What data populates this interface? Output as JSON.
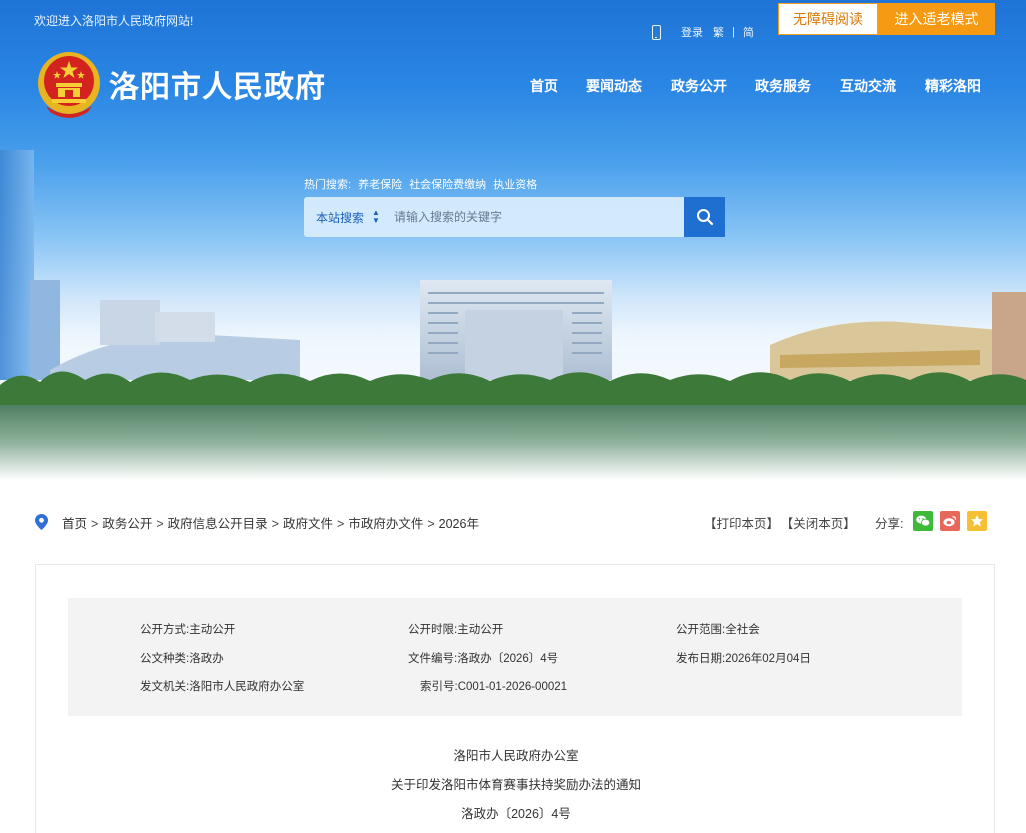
{
  "header": {
    "welcome": "欢迎进入洛阳市人民政府网站!",
    "links": {
      "login": "登录",
      "traditional": "繁",
      "divider": "|",
      "simplified": "简"
    },
    "accessible_button": "无障碍阅读",
    "elder_button": "进入适老模式",
    "site_title": "洛阳市人民政府"
  },
  "nav": {
    "items": [
      "首页",
      "要闻动态",
      "政务公开",
      "政务服务",
      "互动交流",
      "精彩洛阳"
    ]
  },
  "search": {
    "hot_label": "热门搜索:",
    "hot_keywords": [
      "养老保险",
      "社会保险费缴纳",
      "执业资格"
    ],
    "scope": "本站搜索",
    "placeholder": "请输入搜索的关键字"
  },
  "breadcrumb": {
    "items": [
      "首页",
      "政务公开",
      "政府信息公开目录",
      "政府文件",
      "市政府办文件",
      "2026年"
    ],
    "separator": ">"
  },
  "tools": {
    "print": "【打印本页】",
    "close": "【关闭本页】",
    "share_label": "分享:"
  },
  "meta": {
    "row1": [
      {
        "label": "公开方式:",
        "value": "主动公开"
      },
      {
        "label": "公开时限:",
        "value": "主动公开"
      },
      {
        "label": "公开范围:",
        "value": "全社会"
      }
    ],
    "row2": [
      {
        "label": "公文种类:",
        "value": "洛政办"
      },
      {
        "label": "文件编号:",
        "value": "洛政办〔2026〕4号"
      },
      {
        "label": "发布日期:",
        "value": "2026年02月04日"
      }
    ],
    "row3": [
      {
        "label": "发文机关:",
        "value": "洛阳市人民政府办公室"
      },
      {
        "label": "索引号:",
        "value": "C001-01-2026-00021"
      }
    ]
  },
  "document": {
    "issuer": "洛阳市人民政府办公室",
    "title": "关于印发洛阳市体育赛事扶持奖励办法的通知",
    "number": "洛政办〔2026〕4号"
  },
  "colors": {
    "brand_blue": "#1f6fd0",
    "elder_orange": "#f59a12",
    "wechat_green": "#3fb93a",
    "weibo_red": "#e8675b",
    "favorite_yellow": "#f6c034"
  }
}
